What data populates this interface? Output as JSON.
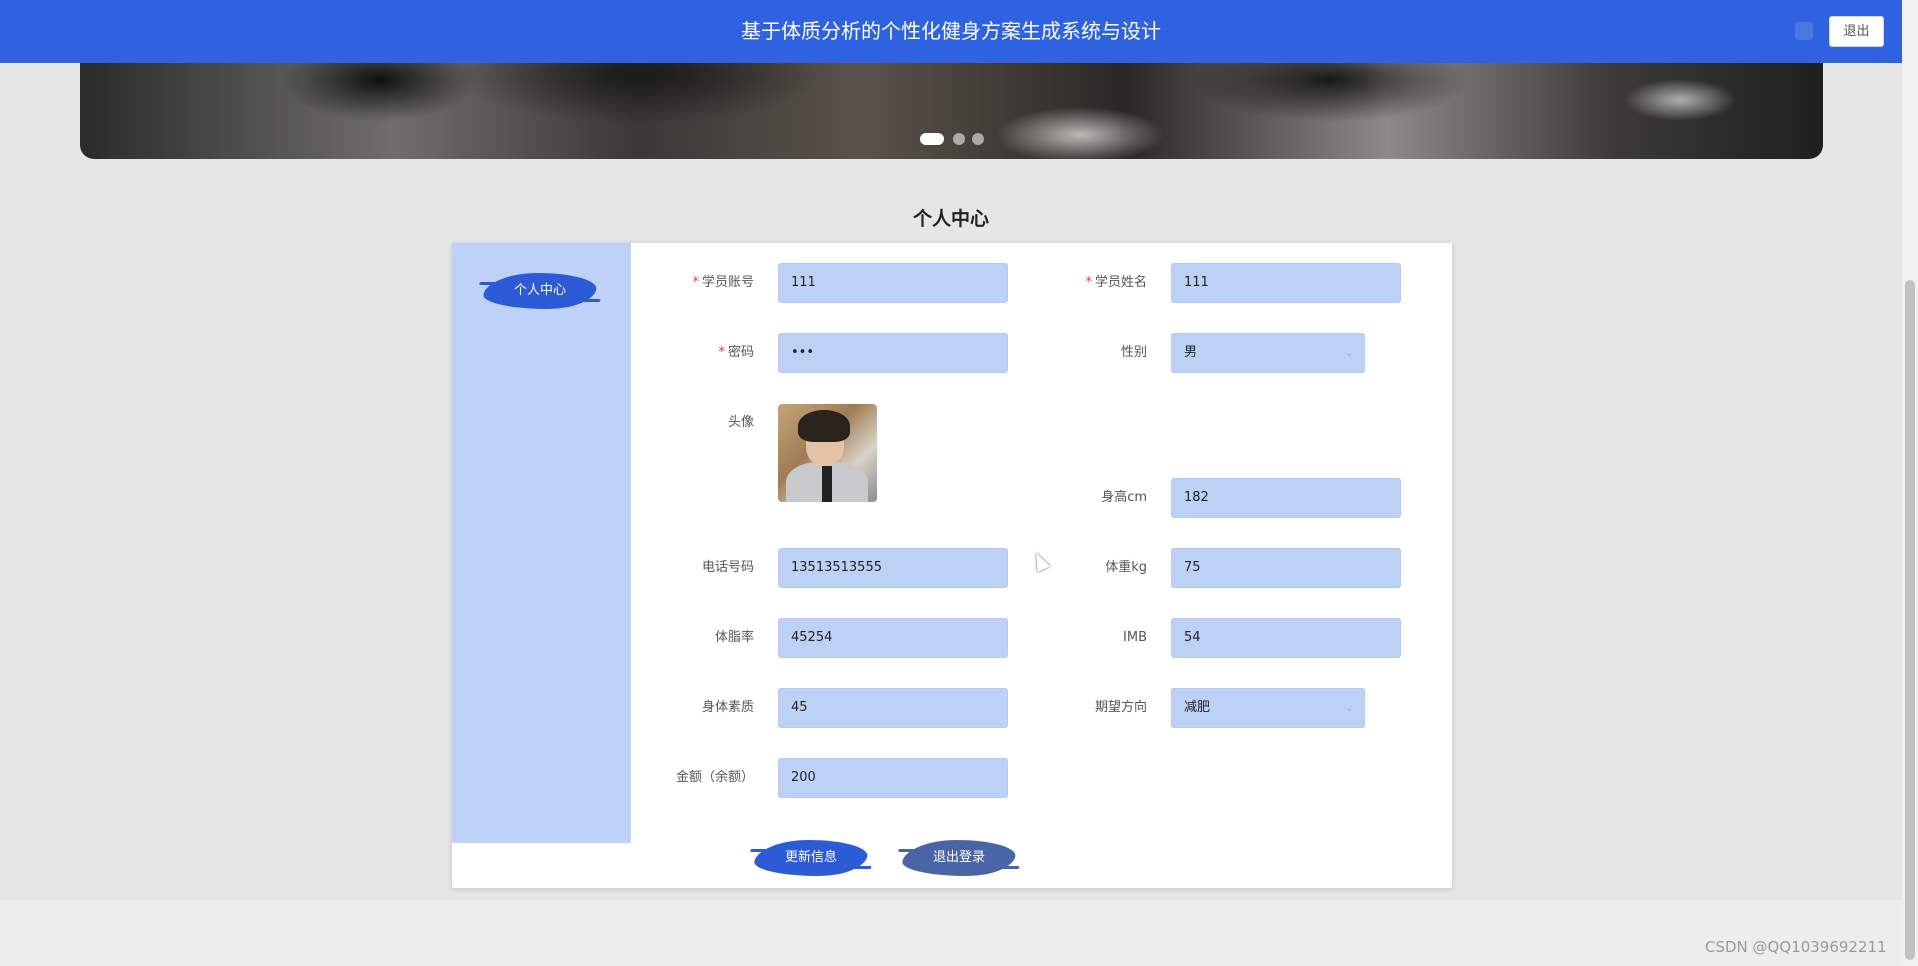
{
  "header": {
    "title": "基于体质分析的个性化健身方案生成系统与设计",
    "logout_label": "退出"
  },
  "carousel": {
    "active_index": 0,
    "slide_count": 3
  },
  "page": {
    "title": "个人中心"
  },
  "sidebar": {
    "items": [
      {
        "label": "个人中心",
        "active": true
      }
    ]
  },
  "form": {
    "account": {
      "label": "学员账号",
      "required": true,
      "value": "111"
    },
    "name": {
      "label": "学员姓名",
      "required": true,
      "value": "111"
    },
    "password": {
      "label": "密码",
      "required": true,
      "value": "•••"
    },
    "gender": {
      "label": "性别",
      "value": "男"
    },
    "avatar": {
      "label": "头像"
    },
    "height": {
      "label": "身高cm",
      "value": "182"
    },
    "phone": {
      "label": "电话号码",
      "value": "13513513555"
    },
    "weight": {
      "label": "体重kg",
      "value": "75"
    },
    "body_fat": {
      "label": "体脂率",
      "value": "45254"
    },
    "imb": {
      "label": "IMB",
      "value": "54"
    },
    "fitness": {
      "label": "身体素质",
      "value": "45"
    },
    "goal": {
      "label": "期望方向",
      "value": "减肥"
    },
    "balance": {
      "label": "金额（余额）",
      "value": "200"
    }
  },
  "actions": {
    "update_label": "更新信息",
    "logout_label": "退出登录"
  },
  "watermark": "CSDN @QQ1039692211",
  "colors": {
    "topbar": "#2f62e0",
    "sidebar": "#bed2f7",
    "input_bg": "#bdd0f6",
    "required": "#e03a3a"
  }
}
